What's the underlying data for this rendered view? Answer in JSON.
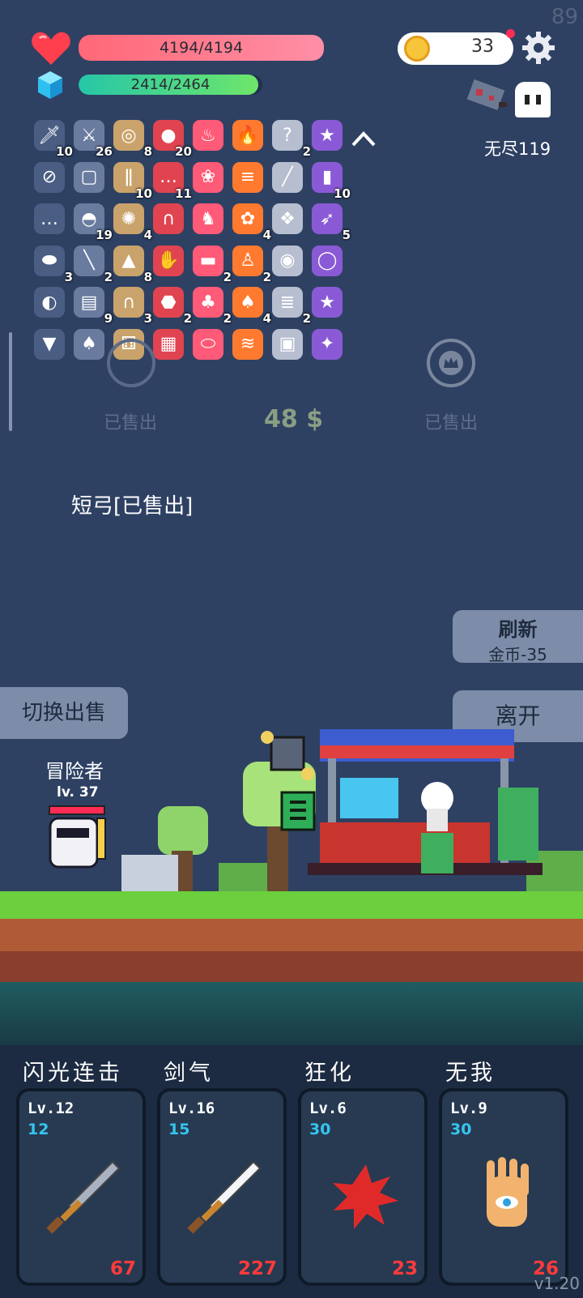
{
  "fps": "89",
  "hp": {
    "text": "4194/4194",
    "fraction": 1.0,
    "color": "#ff7890"
  },
  "mp": {
    "text": "2414/2464",
    "fraction": 0.98,
    "color": "#5cdc84"
  },
  "coins": "33",
  "mode_label": "无尽119",
  "inventory": [
    {
      "icon": "dagger-icon",
      "glyph": "🗡",
      "count": "10"
    },
    {
      "icon": "sword-icon",
      "glyph": "⚔",
      "count": "26"
    },
    {
      "icon": "shield-icon",
      "glyph": "◎",
      "count": "8"
    },
    {
      "icon": "apple-icon",
      "glyph": "●",
      "count": "20"
    },
    {
      "icon": "flame-pink-icon",
      "glyph": "♨",
      "count": ""
    },
    {
      "icon": "fire-icon",
      "glyph": "🔥",
      "count": ""
    },
    {
      "icon": "hook-icon",
      "glyph": "?",
      "count": "2"
    },
    {
      "icon": "chest-purple-icon",
      "glyph": "★",
      "count": ""
    },
    {
      "icon": "safety-pin-icon",
      "glyph": "⊘",
      "count": ""
    },
    {
      "icon": "cloth-icon",
      "glyph": "▢",
      "count": ""
    },
    {
      "icon": "thermometer-icon",
      "glyph": "ǁ",
      "count": "10"
    },
    {
      "icon": "chat-bubble-icon",
      "glyph": "…",
      "count": "11"
    },
    {
      "icon": "ice-cream-icon",
      "glyph": "❀",
      "count": ""
    },
    {
      "icon": "scroll-icon",
      "glyph": "≡",
      "count": ""
    },
    {
      "icon": "blade-icon",
      "glyph": "╱",
      "count": ""
    },
    {
      "icon": "beer-icon",
      "glyph": "▮",
      "count": "10"
    },
    {
      "icon": "speech-icon",
      "glyph": "…",
      "count": ""
    },
    {
      "icon": "watermelon-icon",
      "glyph": "◓",
      "count": "19"
    },
    {
      "icon": "sunflower-icon",
      "glyph": "✺",
      "count": "4"
    },
    {
      "icon": "magnet-icon",
      "glyph": "∩",
      "count": ""
    },
    {
      "icon": "helmet-icon",
      "glyph": "♞",
      "count": ""
    },
    {
      "icon": "flower-icon",
      "glyph": "✿",
      "count": "4"
    },
    {
      "icon": "network-icon",
      "glyph": "❖",
      "count": ""
    },
    {
      "icon": "bow-icon",
      "glyph": "➶",
      "count": "5"
    },
    {
      "icon": "pill-icon",
      "glyph": "⬬",
      "count": "3"
    },
    {
      "icon": "syringe-icon",
      "glyph": "╲",
      "count": "2"
    },
    {
      "icon": "potion-icon",
      "glyph": "▲",
      "count": "8"
    },
    {
      "icon": "hand-icon",
      "glyph": "✋",
      "count": ""
    },
    {
      "icon": "briefcase-icon",
      "glyph": "▬",
      "count": "2"
    },
    {
      "icon": "coat-icon",
      "glyph": "♙",
      "count": "2"
    },
    {
      "icon": "spiral-icon",
      "glyph": "◉",
      "count": ""
    },
    {
      "icon": "ring-icon",
      "glyph": "◯",
      "count": ""
    },
    {
      "icon": "compass-icon",
      "glyph": "◐",
      "count": ""
    },
    {
      "icon": "book-icon",
      "glyph": "▤",
      "count": "9"
    },
    {
      "icon": "tombstone-icon",
      "glyph": "∩",
      "count": "3"
    },
    {
      "icon": "egg-icon",
      "glyph": "⬣",
      "count": "2"
    },
    {
      "icon": "potted-flower-icon",
      "glyph": "♣",
      "count": "2"
    },
    {
      "icon": "pineapple-icon",
      "glyph": "♠",
      "count": "4"
    },
    {
      "icon": "parchment-icon",
      "glyph": "≣",
      "count": "2"
    },
    {
      "icon": "star-card-icon",
      "glyph": "★",
      "count": ""
    },
    {
      "icon": "cake-icon",
      "glyph": "▼",
      "count": ""
    },
    {
      "icon": "cards-icon",
      "glyph": "♠",
      "count": ""
    },
    {
      "icon": "dice-icon",
      "glyph": "⚅",
      "count": ""
    },
    {
      "icon": "map-icon",
      "glyph": "▦",
      "count": ""
    },
    {
      "icon": "capsule-icon",
      "glyph": "⬭",
      "count": ""
    },
    {
      "icon": "heat-icon",
      "glyph": "≋",
      "count": ""
    },
    {
      "icon": "jam-jar-icon",
      "glyph": "▣",
      "count": ""
    },
    {
      "icon": "lightbulb-icon",
      "glyph": "✦",
      "count": ""
    }
  ],
  "shop": {
    "left_status": "已售出",
    "price": "48 $",
    "right_status": "已售出",
    "item_description": "短弓[已售出]"
  },
  "buttons": {
    "refresh_title": "刷新",
    "refresh_cost": "金币-35",
    "leave": "离开",
    "switch_sell": "切换出售"
  },
  "hero": {
    "name": "冒险者",
    "level": "lv. 37",
    "hp_fraction": 1.0
  },
  "skills": [
    {
      "name": "闪光连击",
      "level": "Lv.12",
      "cost": "12",
      "value": "67",
      "icon": "sword-icon"
    },
    {
      "name": "剑气",
      "level": "Lv.16",
      "cost": "15",
      "value": "227",
      "icon": "sword-icon"
    },
    {
      "name": "狂化",
      "level": "Lv.6",
      "cost": "30",
      "value": "23",
      "icon": "red-splat-icon"
    },
    {
      "name": "无我",
      "level": "Lv.9",
      "cost": "30",
      "value": "26",
      "icon": "eye-hand-icon"
    }
  ],
  "version": "v1.20"
}
